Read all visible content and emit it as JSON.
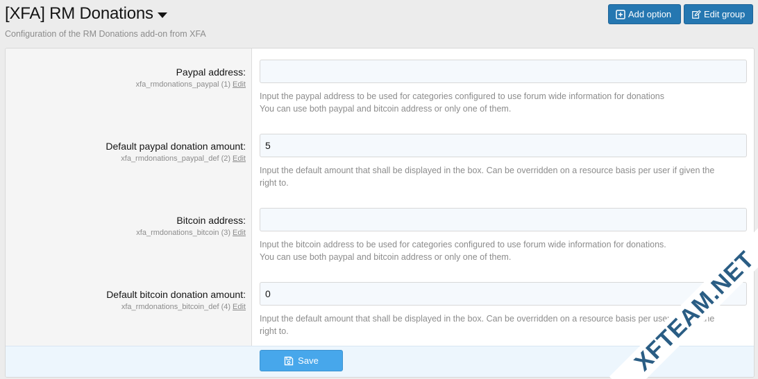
{
  "header": {
    "title": "[XFA] RM Donations",
    "subtitle": "Configuration of the RM Donations add-on from XFA",
    "add_option_label": "Add option",
    "edit_group_label": "Edit group"
  },
  "options": [
    {
      "label": "Paypal address:",
      "id_text": "xfa_rmdonations_paypal (1)",
      "edit_label": "Edit",
      "value": "",
      "hint_lines": [
        "Input the paypal address to be used for categories configured to use forum wide information for donations",
        "You can use both paypal and bitcoin address or only one of them."
      ]
    },
    {
      "label": "Default paypal donation amount:",
      "id_text": "xfa_rmdonations_paypal_def (2)",
      "edit_label": "Edit",
      "value": "5",
      "hint_lines": [
        "Input the default amount that shall be displayed in the box. Can be overridden on a resource basis per user if given the",
        "right to."
      ]
    },
    {
      "label": "Bitcoin address:",
      "id_text": "xfa_rmdonations_bitcoin (3)",
      "edit_label": "Edit",
      "value": "",
      "hint_lines": [
        "Input the bitcoin address to be used for categories configured to use forum wide information for donations.",
        "You can use both paypal and bitcoin address or only one of them."
      ]
    },
    {
      "label": "Default bitcoin donation amount:",
      "id_text": "xfa_rmdonations_bitcoin_def (4)",
      "edit_label": "Edit",
      "value": "0",
      "hint_lines": [
        "Input the default amount that shall be displayed in the box. Can be overridden on a resource basis per user if given the",
        "right to."
      ]
    }
  ],
  "footer": {
    "save_label": "Save"
  },
  "watermark": "XFTEAM.NET",
  "icons": {
    "add_option": "plus-square-icon",
    "edit_group": "edit-icon",
    "save": "floppy-disk-icon",
    "title_menu": "caret-down-icon"
  },
  "colors": {
    "primary_button": "#2577b1",
    "save_button": "#47a7eb",
    "footer_bg": "#edf6fd",
    "label_column_bg": "#f5f5f5",
    "watermark": "#2a5d84"
  }
}
